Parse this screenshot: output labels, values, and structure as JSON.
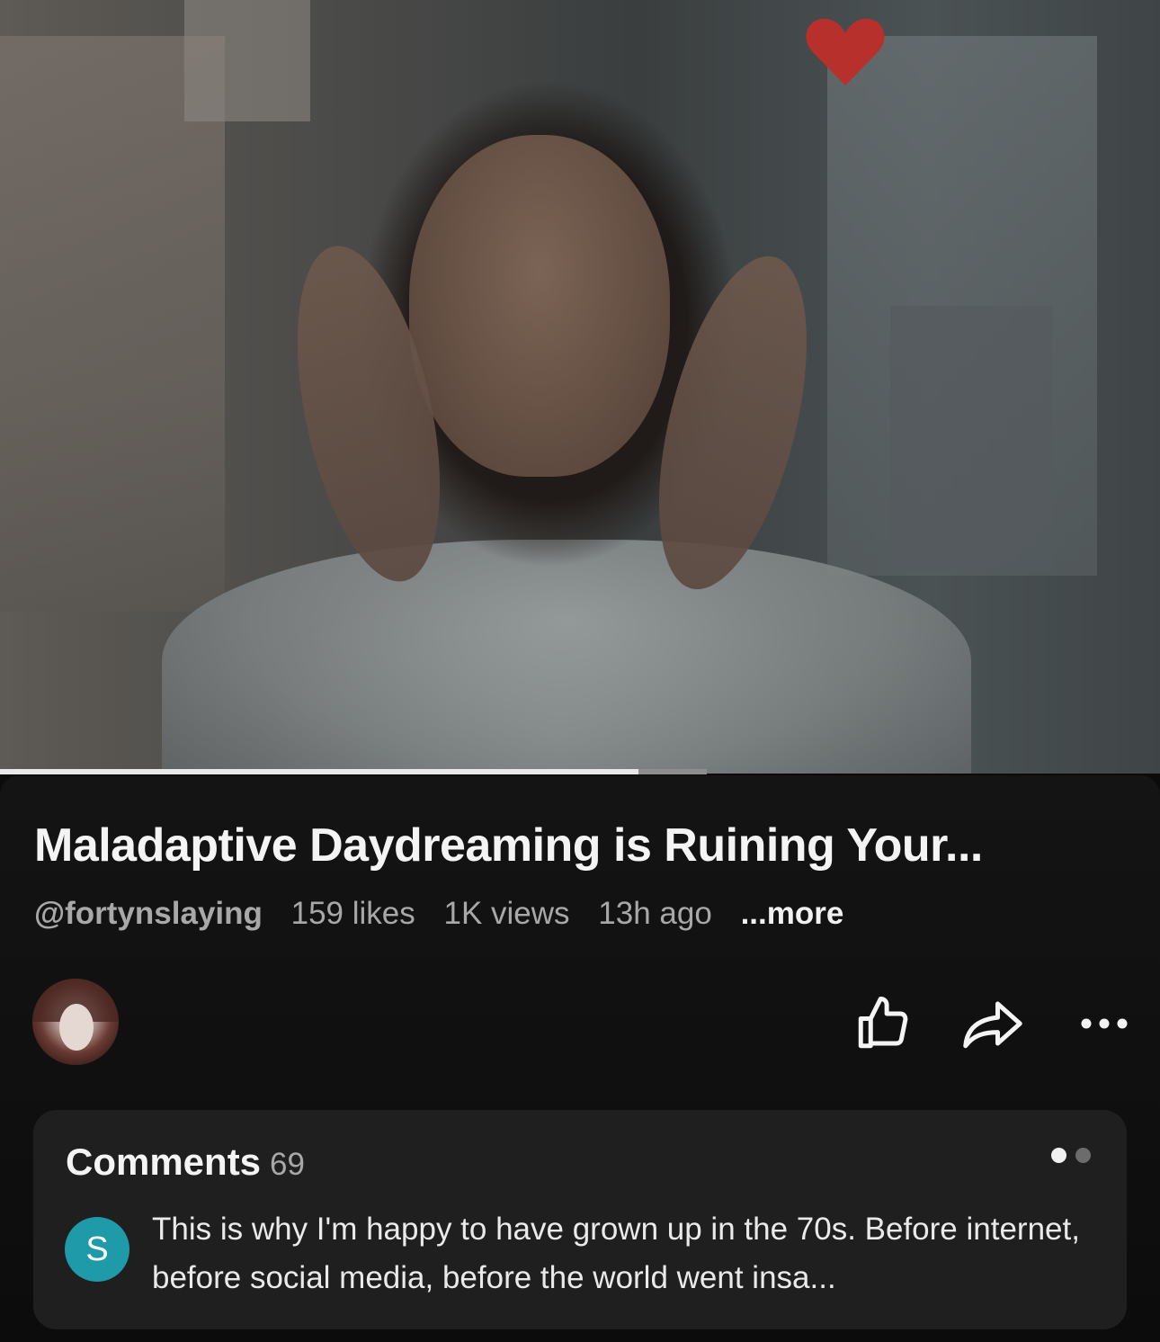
{
  "video": {
    "description_icon": "video-frame",
    "progress": 0.55
  },
  "title": "Maladaptive Daydreaming is Ruining Your...",
  "meta": {
    "handle": "@fortynslaying",
    "likes": "159 likes",
    "views": "1K views",
    "time": "13h ago",
    "more": "...more"
  },
  "actions": {
    "like_icon": "thumbs-up-icon",
    "share_icon": "share-arrow-icon",
    "more_icon": "more-horizontal-icon"
  },
  "comments": {
    "label": "Comments",
    "count": "69",
    "first": {
      "avatar_letter": "S",
      "text": "This is why I'm happy to have grown up in the 70s. Before internet, before social media, before the world went insa..."
    }
  },
  "colors": {
    "background": "#0b0b0b",
    "comment_card": "#1f1f1f",
    "comment_avatar": "#1e9aa8",
    "meta_text": "#a8a8a8"
  }
}
